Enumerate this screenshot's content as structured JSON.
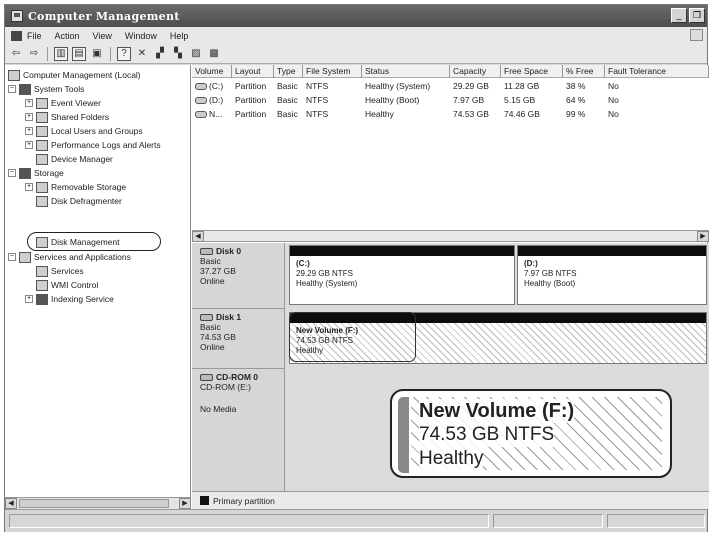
{
  "window": {
    "title": "Computer Management"
  },
  "menu": [
    "File",
    "Action",
    "View",
    "Window",
    "Help"
  ],
  "toolbar_icons": [
    "back-icon",
    "forward-icon",
    "show-hide-tree-icon",
    "up-icon",
    "properties-icon",
    "help-icon",
    "delete-icon",
    "connect-drive-icon",
    "open-icon",
    "search-icon",
    "refresh-icon"
  ],
  "tree": {
    "root": "Computer Management (Local)",
    "system_tools": "System Tools",
    "event_viewer": "Event Viewer",
    "shared_folders": "Shared Folders",
    "local_users": "Local Users and Groups",
    "perf_logs": "Performance Logs and Alerts",
    "device_manager": "Device Manager",
    "storage": "Storage",
    "removable_storage": "Removable Storage",
    "disk_defrag": "Disk Defragmenter",
    "disk_management": "Disk Management",
    "services_apps": "Services and Applications",
    "services": "Services",
    "wmi_control": "WMI Control",
    "indexing_service": "Indexing Service"
  },
  "volume_table": {
    "columns": [
      "Volume",
      "Layout",
      "Type",
      "File System",
      "Status",
      "Capacity",
      "Free Space",
      "% Free",
      "Fault Tolerance"
    ],
    "rows": [
      [
        "(C:)",
        "Partition",
        "Basic",
        "NTFS",
        "Healthy (System)",
        "29.29 GB",
        "11.28 GB",
        "38 %",
        "No"
      ],
      [
        "(D:)",
        "Partition",
        "Basic",
        "NTFS",
        "Healthy (Boot)",
        "7.97 GB",
        "5.15 GB",
        "64 %",
        "No"
      ],
      [
        "N...",
        "Partition",
        "Basic",
        "NTFS",
        "Healthy",
        "74.53 GB",
        "74.46 GB",
        "99 %",
        "No"
      ]
    ]
  },
  "disks": {
    "disk0": {
      "name": "Disk 0",
      "type": "Basic",
      "size": "37.27 GB",
      "status": "Online",
      "partitions": [
        {
          "name": "(C:)",
          "size": "29.29 GB NTFS",
          "status": "Healthy (System)"
        },
        {
          "name": "(D:)",
          "size": "7.97 GB NTFS",
          "status": "Healthy (Boot)"
        }
      ]
    },
    "disk1": {
      "name": "Disk 1",
      "type": "Basic",
      "size": "74.53 GB",
      "status": "Online",
      "partition": {
        "name": "New Volume (F:)",
        "size": "74.53 GB NTFS",
        "status": "Healthy"
      }
    },
    "cdrom": {
      "name": "CD-ROM 0",
      "type": "CD-ROM (E:)",
      "status": "No Media"
    }
  },
  "callout": {
    "name": "New Volume  (F:)",
    "size": "74.53 GB NTFS",
    "status": "Healthy"
  },
  "legend": {
    "primary": "Primary partition"
  }
}
